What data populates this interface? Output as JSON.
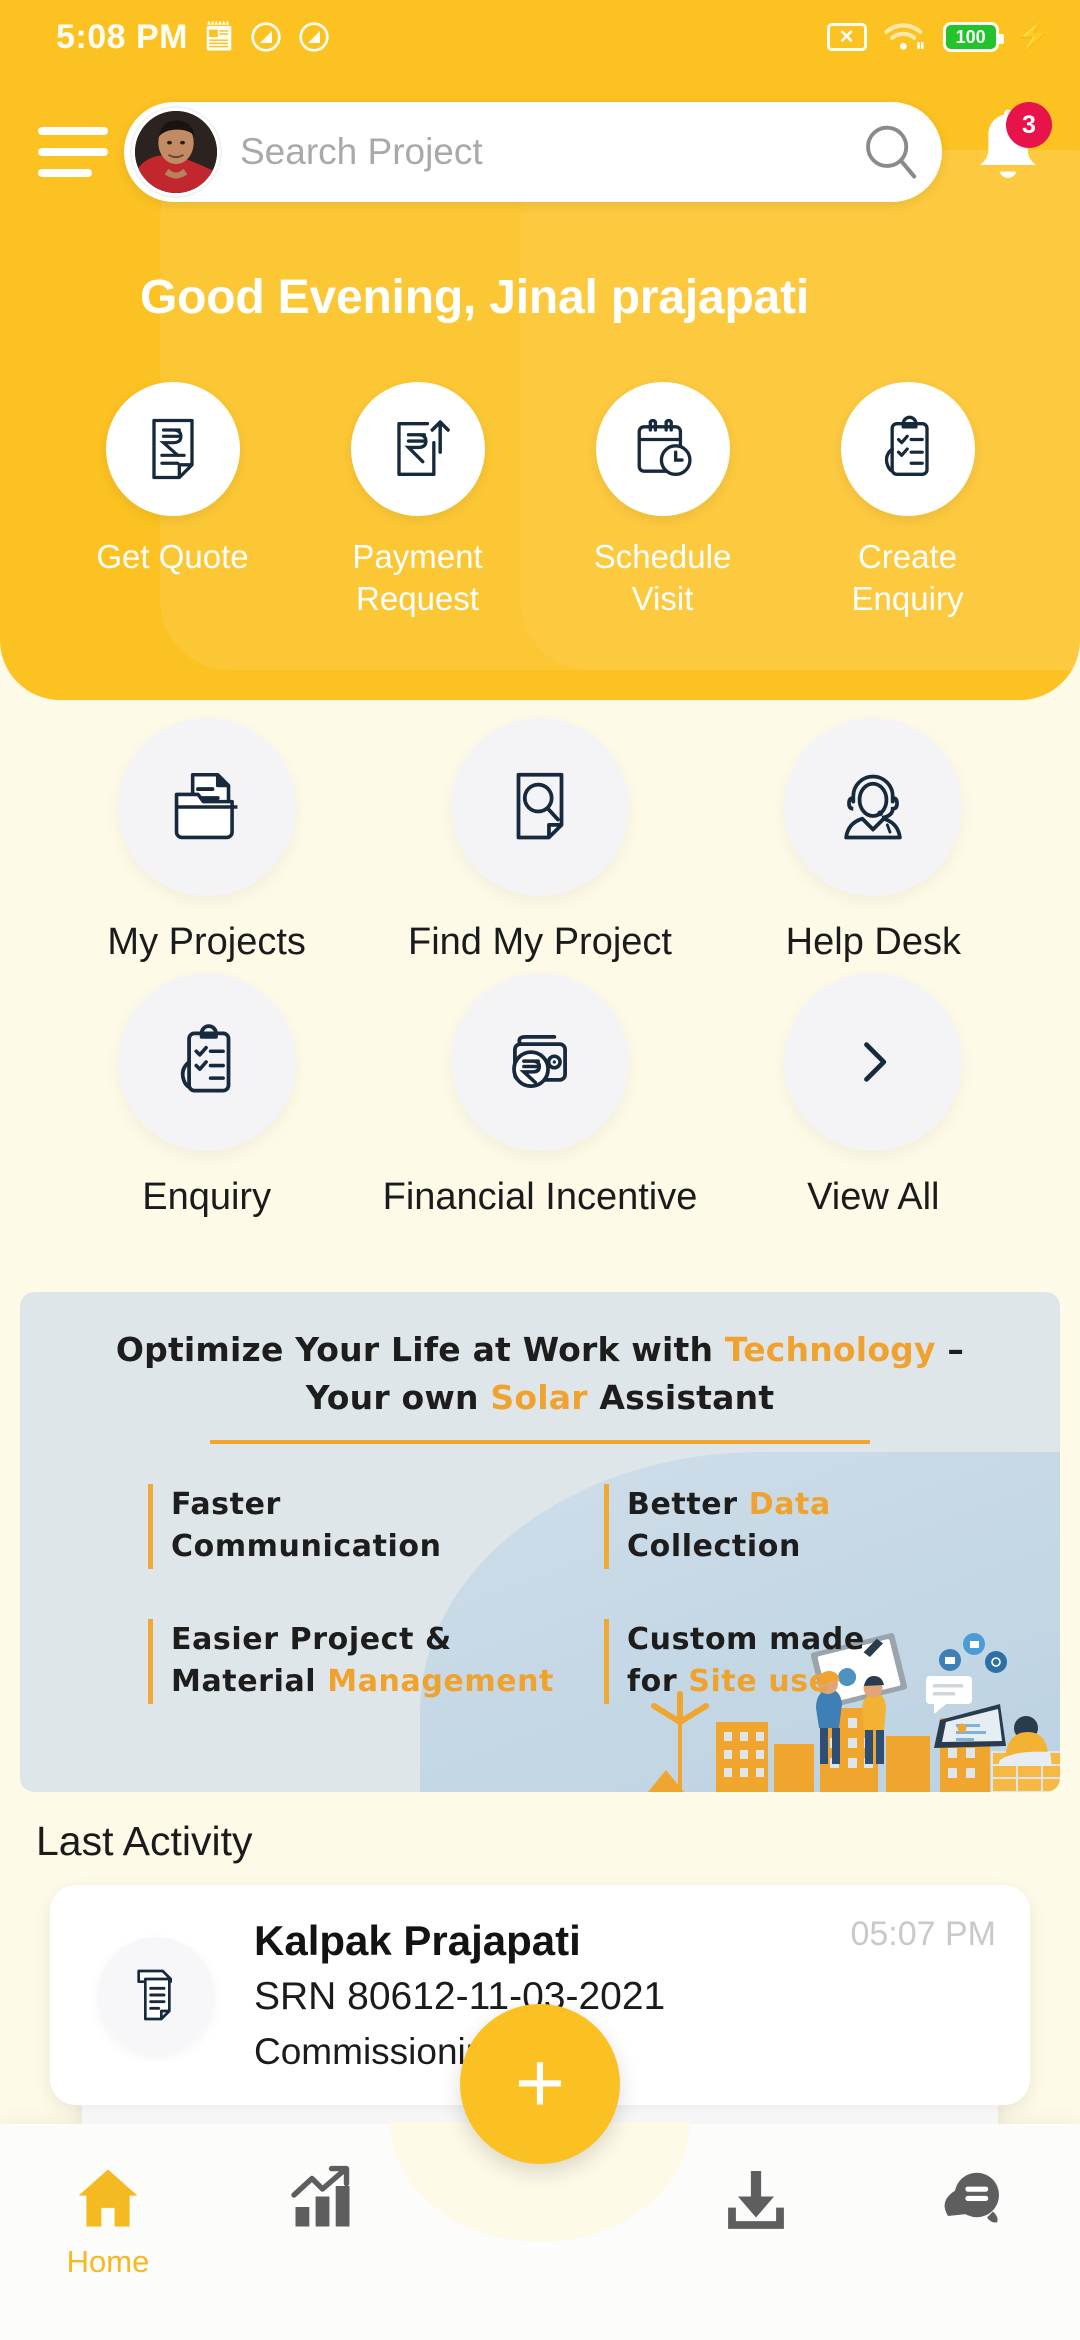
{
  "statusbar": {
    "time": "5:08 PM",
    "calendar_icon": "calendar-icon",
    "dnd_icon_1": "do-not-disturb-icon",
    "dnd_icon_2": "do-not-disturb-icon",
    "sim_icon": "sim-card-off-icon",
    "wifi_icon": "wifi-icon",
    "battery_level": "100",
    "charging_icon": "charging-bolt-icon"
  },
  "header": {
    "menu_icon": "hamburger-menu-icon",
    "avatar": "user-avatar",
    "search_placeholder": "Search Project",
    "search_value": "",
    "search_icon": "search-icon",
    "bell_icon": "notification-bell-icon",
    "notification_count": "3",
    "greeting": "Good Evening, Jinal prajapati",
    "quick_actions": [
      {
        "label": "Get Quote",
        "icon": "rupee-document-icon"
      },
      {
        "label": "Payment Request",
        "icon": "rupee-upload-icon"
      },
      {
        "label": "Schedule Visit",
        "icon": "calendar-clock-icon"
      },
      {
        "label": "Create Enquiry",
        "icon": "clipboard-check-icon"
      }
    ]
  },
  "grid": {
    "items": [
      {
        "label": "My Projects",
        "icon": "folder-document-icon"
      },
      {
        "label": "Find My Project",
        "icon": "document-search-icon"
      },
      {
        "label": "Help Desk",
        "icon": "headset-support-icon"
      },
      {
        "label": "Enquiry",
        "icon": "clipboard-check-icon"
      },
      {
        "label": "Financial Incentive",
        "icon": "wallet-rupee-icon"
      },
      {
        "label": "View All",
        "icon": "chevron-right-icon"
      }
    ]
  },
  "banner": {
    "title_part1": "Optimize Your Life at Work with ",
    "title_highlight1": "Technology",
    "title_part2": " –",
    "title_line2_part1": "Your own ",
    "title_line2_highlight": "Solar",
    "title_line2_part2": " Assistant",
    "features": [
      {
        "line1": "Faster",
        "line1_color": "orange",
        "line2": "Communication",
        "line2_color": "dark"
      },
      {
        "line1_a": "Better ",
        "line1_b": "Data",
        "line2": "Collection",
        "style": "mixed"
      },
      {
        "line1": "Easier Project &",
        "line2_a": "Material ",
        "line2_b": "Management",
        "style": "mixed2"
      },
      {
        "line1": "Custom made",
        "line2_a": "for ",
        "line2_b": "Site use",
        "style": "mixed3"
      }
    ],
    "illustration": "solar-city-workers-illustration"
  },
  "last_activity": {
    "section_title": "Last Activity",
    "items": [
      {
        "icon": "document-stack-icon",
        "name": "Kalpak  Prajapati",
        "srn": "SRN 80612-11-03-2021",
        "stage": "Commissioning",
        "time": "05:07 PM"
      }
    ]
  },
  "bottom_nav": {
    "fab_icon": "plus-icon",
    "items": [
      {
        "label": "Home",
        "icon": "home-icon",
        "active": true
      },
      {
        "label": "",
        "icon": "chart-growth-icon",
        "active": false
      },
      {
        "label": "",
        "icon": "download-icon",
        "active": false
      },
      {
        "label": "",
        "icon": "chat-bubble-icon",
        "active": false
      }
    ]
  },
  "colors": {
    "brand_yellow": "#FCC222",
    "page_bg": "#FEFAE8",
    "banner_bg": "#DFE6EA",
    "accent_orange": "#EFA530",
    "badge_red": "#E8134B",
    "icon_navy": "#16293D",
    "nav_inactive": "#5E5E5E"
  }
}
